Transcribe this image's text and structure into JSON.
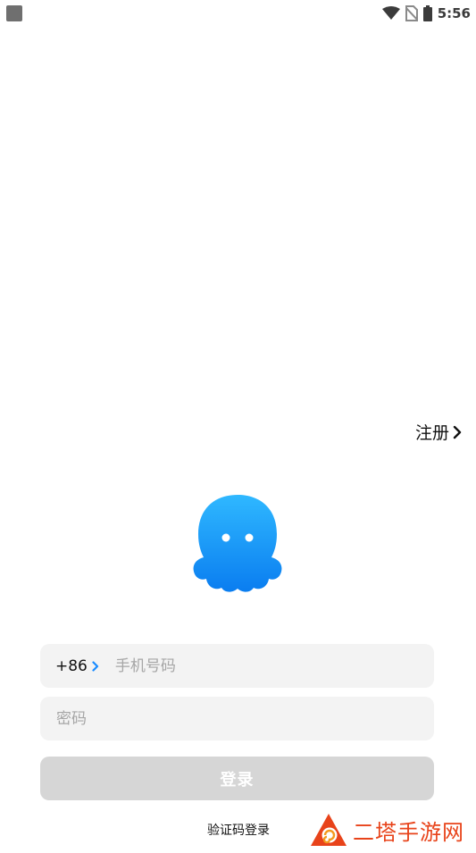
{
  "status_bar": {
    "time": "5:56",
    "icons": [
      "app-notification-icon",
      "wifi-icon",
      "no-sim-icon",
      "battery-icon"
    ]
  },
  "header": {
    "register_label": "注册"
  },
  "login_form": {
    "country_code": "+86",
    "phone_placeholder": "手机号码",
    "password_placeholder": "密码",
    "login_button_label": "登录",
    "code_login_label": "验证码登录"
  },
  "watermark": {
    "text": "二塔手游网"
  },
  "colors": {
    "brand_blue": "#1a9bff",
    "accent_link": "#1a8cff",
    "disabled_button": "#d6d6d6",
    "field_background": "#f3f3f3",
    "watermark": "#e8431a"
  }
}
